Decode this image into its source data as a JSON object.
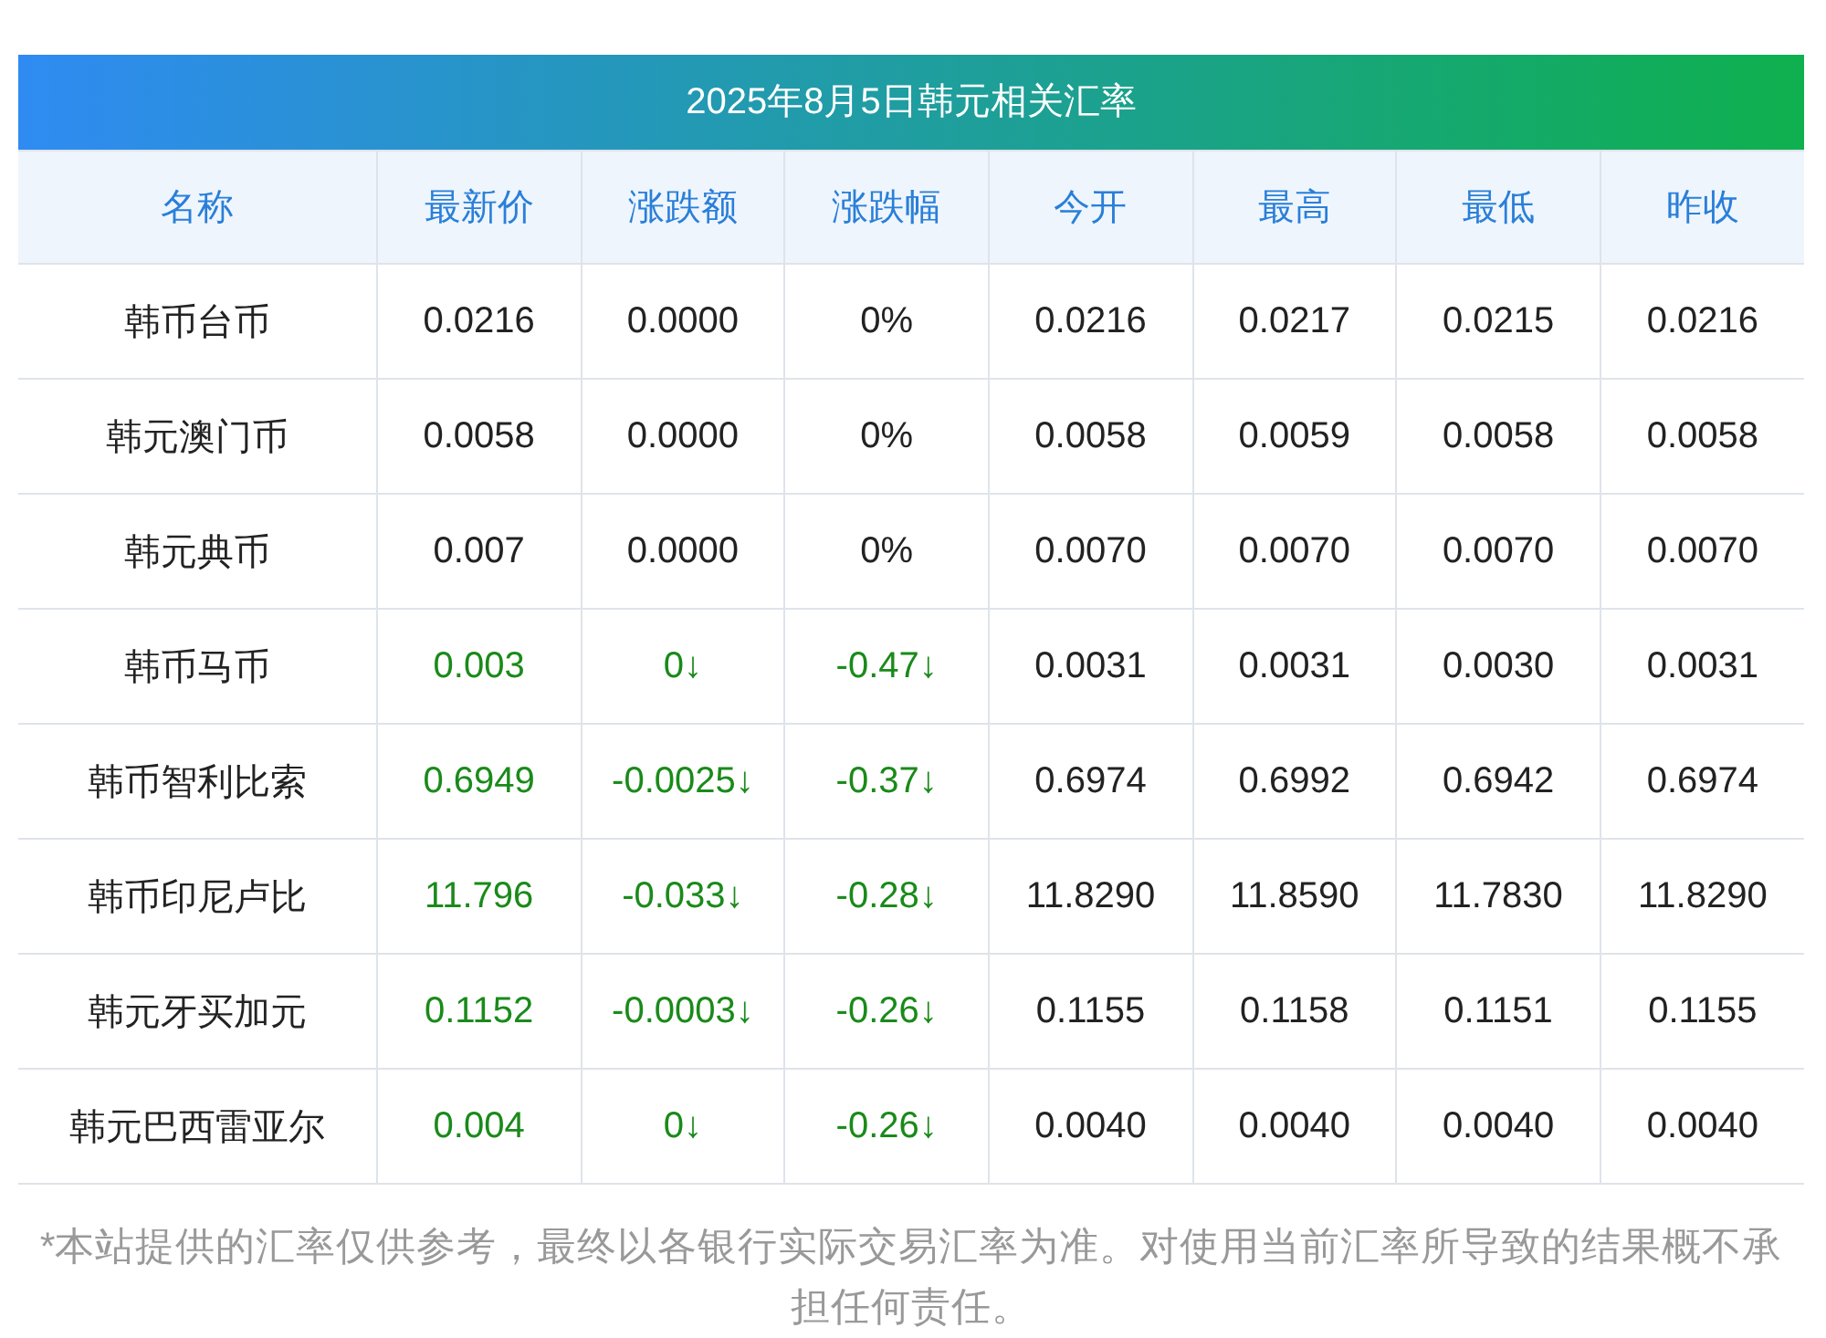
{
  "title": "2025年8月5日韩元相关汇率",
  "columns": [
    "名称",
    "最新价",
    "涨跌额",
    "涨跌幅",
    "今开",
    "最高",
    "最低",
    "昨收"
  ],
  "rows": [
    {
      "falling": false,
      "cells": [
        "韩币台币",
        "0.0216",
        "0.0000",
        "0%",
        "0.0216",
        "0.0217",
        "0.0215",
        "0.0216"
      ]
    },
    {
      "falling": false,
      "cells": [
        "韩元澳门币",
        "0.0058",
        "0.0000",
        "0%",
        "0.0058",
        "0.0059",
        "0.0058",
        "0.0058"
      ]
    },
    {
      "falling": false,
      "cells": [
        "韩元典币",
        "0.007",
        "0.0000",
        "0%",
        "0.0070",
        "0.0070",
        "0.0070",
        "0.0070"
      ]
    },
    {
      "falling": true,
      "cells": [
        "韩币马币",
        "0.003",
        "0↓",
        "-0.47↓",
        "0.0031",
        "0.0031",
        "0.0030",
        "0.0031"
      ]
    },
    {
      "falling": true,
      "cells": [
        "韩币智利比索",
        "0.6949",
        "-0.0025↓",
        "-0.37↓",
        "0.6974",
        "0.6992",
        "0.6942",
        "0.6974"
      ]
    },
    {
      "falling": true,
      "cells": [
        "韩币印尼卢比",
        "11.796",
        "-0.033↓",
        "-0.28↓",
        "11.8290",
        "11.8590",
        "11.7830",
        "11.8290"
      ]
    },
    {
      "falling": true,
      "cells": [
        "韩元牙买加元",
        "0.1152",
        "-0.0003↓",
        "-0.26↓",
        "0.1155",
        "0.1158",
        "0.1151",
        "0.1155"
      ]
    },
    {
      "falling": true,
      "cells": [
        "韩元巴西雷亚尔",
        "0.004",
        "0↓",
        "-0.26↓",
        "0.0040",
        "0.0040",
        "0.0040",
        "0.0040"
      ]
    }
  ],
  "note": "*本站提供的汇率仅供参考，最终以各银行实际交易汇率为准。对使用当前汇率所导致的结果概不承担任何责任。"
}
